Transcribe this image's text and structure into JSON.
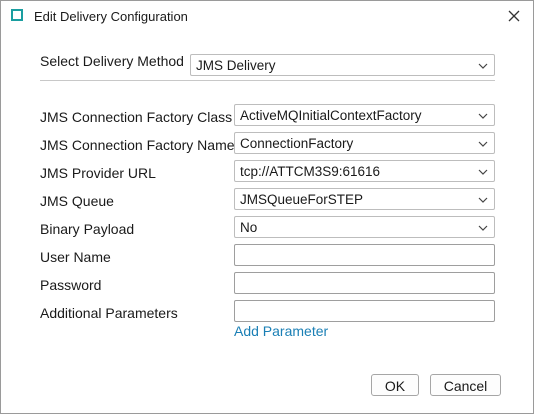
{
  "window": {
    "title": "Edit Delivery Configuration"
  },
  "icons": {
    "app": "app-icon",
    "close": "close-icon",
    "dropdown": "chevron-down-icon"
  },
  "delivery_method": {
    "label": "Select Delivery Method",
    "value": "JMS Delivery"
  },
  "fields": {
    "factory_class": {
      "label": "JMS Connection Factory Class",
      "value": "ActiveMQInitialContextFactory"
    },
    "factory_name": {
      "label": "JMS Connection Factory Name",
      "value": "ConnectionFactory"
    },
    "provider_url": {
      "label": "JMS Provider URL",
      "value": "tcp://ATTCM3S9:61616"
    },
    "queue": {
      "label": "JMS Queue",
      "value": "JMSQueueForSTEP"
    },
    "binary_payload": {
      "label": "Binary Payload",
      "value": "No"
    },
    "user_name": {
      "label": "User Name",
      "value": ""
    },
    "password": {
      "label": "Password",
      "value": ""
    },
    "additional_params": {
      "label": "Additional Parameters",
      "value": ""
    }
  },
  "add_parameter_link": "Add Parameter",
  "buttons": {
    "ok": "OK",
    "cancel": "Cancel"
  },
  "colors": {
    "accent": "#1a9ea0",
    "link": "#1a7fb5"
  }
}
